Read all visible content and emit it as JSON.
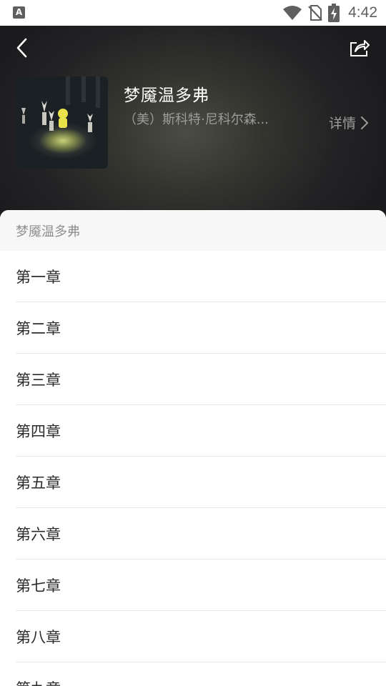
{
  "status_bar": {
    "time": "4:42",
    "app_icon_letter": "A",
    "icons": [
      "wifi-icon",
      "no-sim-icon",
      "battery-charging-icon"
    ]
  },
  "header": {
    "book_title": "梦魇温多弗",
    "author": "（美）斯科特·尼科尔森...",
    "details_label": "详情",
    "back_icon": "chevron-left-icon",
    "share_icon": "share-icon"
  },
  "catalog": {
    "title": "梦魇温多弗",
    "chapters": [
      "第一章",
      "第二章",
      "第三章",
      "第四章",
      "第五章",
      "第六章",
      "第七章",
      "第八章",
      "第九章"
    ]
  },
  "colors": {
    "header_bg": "#1f1f21",
    "title_text": "#ffffff",
    "muted_text": "#9c9c9a",
    "chapter_text": "#2b2b2b",
    "divider": "#e9e9e9",
    "sheet_header_bg": "#f7f7f7"
  }
}
